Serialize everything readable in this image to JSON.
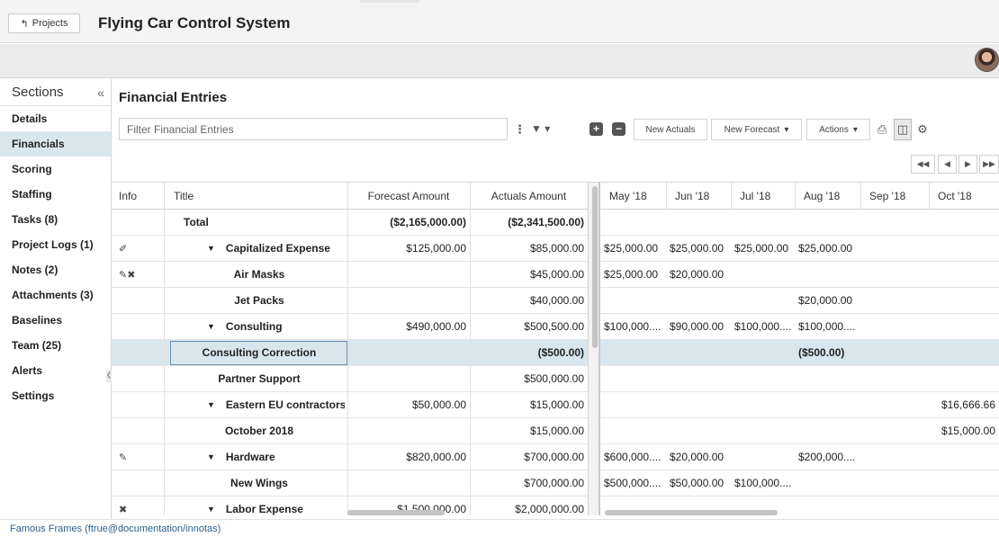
{
  "topbar": {
    "projects_label": "Projects",
    "app_title": "Flying Car Control System"
  },
  "sidebar": {
    "header": "Sections",
    "collapse_glyph": "«",
    "items": [
      {
        "label": "Details"
      },
      {
        "label": "Financials"
      },
      {
        "label": "Scoring"
      },
      {
        "label": "Staffing"
      },
      {
        "label": "Tasks (8)"
      },
      {
        "label": "Project Logs (1)"
      },
      {
        "label": "Notes (2)"
      },
      {
        "label": "Attachments (3)"
      },
      {
        "label": "Baselines"
      },
      {
        "label": "Team (25)"
      },
      {
        "label": "Alerts"
      },
      {
        "label": "Settings"
      }
    ],
    "active_index": 1
  },
  "main": {
    "title": "Financial Entries",
    "filter_placeholder": "Filter Financial Entries",
    "toolbar": {
      "new_actuals": "New Actuals",
      "new_forecast": "New Forecast",
      "actions": "Actions"
    }
  },
  "grid": {
    "headers": {
      "info": "Info",
      "title": "Title",
      "forecast": "Forecast Amount",
      "actuals": "Actuals Amount",
      "months": [
        "May '18",
        "Jun '18",
        "Jul '18",
        "Aug '18",
        "Sep '18",
        "Oct '18"
      ]
    },
    "rows": [
      {
        "title": "Total",
        "forecast": "($2,165,000.00)",
        "actuals": "($2,341,500.00)",
        "months": [
          "",
          "",
          "",
          "",
          "",
          ""
        ],
        "bold_amounts": true
      },
      {
        "info": "paperclip-icon",
        "title": "Capitalized Expense",
        "caret": true,
        "forecast": "$125,000.00",
        "actuals": "$85,000.00",
        "months": [
          "$25,000.00",
          "$25,000.00",
          "$25,000.00",
          "$25,000.00",
          "",
          ""
        ]
      },
      {
        "info": "edit-expand-icons",
        "title": "Air Masks",
        "indent": 2,
        "forecast": "",
        "actuals": "$45,000.00",
        "months": [
          "$25,000.00",
          "$20,000.00",
          "",
          "",
          "",
          ""
        ]
      },
      {
        "title": "Jet Packs",
        "indent": 2,
        "forecast": "",
        "actuals": "$40,000.00",
        "months": [
          "",
          "",
          "",
          "$20,000.00",
          "",
          ""
        ]
      },
      {
        "title": "Consulting",
        "caret": true,
        "forecast": "$490,000.00",
        "actuals": "$500,500.00",
        "months": [
          "$100,000....",
          "$90,000.00",
          "$100,000....",
          "$100,000....",
          "",
          ""
        ]
      },
      {
        "title": "Consulting Correction",
        "indent": 2,
        "forecast": "",
        "actuals": "($500.00)",
        "months": [
          "",
          "",
          "",
          "($500.00)",
          "",
          ""
        ],
        "selected": true
      },
      {
        "title": "Partner Support",
        "indent": 2,
        "forecast": "",
        "actuals": "$500,000.00",
        "months": [
          "",
          "",
          "",
          "",
          "",
          ""
        ]
      },
      {
        "title": "Eastern EU contractors",
        "caret": true,
        "forecast": "$50,000.00",
        "actuals": "$15,000.00",
        "months": [
          "",
          "",
          "",
          "",
          "",
          "$16,666.66"
        ]
      },
      {
        "title": "October 2018",
        "indent": 2,
        "forecast": "",
        "actuals": "$15,000.00",
        "months": [
          "",
          "",
          "",
          "",
          "",
          "$15,000.00"
        ]
      },
      {
        "info": "edit-icon",
        "title": "Hardware",
        "caret": true,
        "forecast": "$820,000.00",
        "actuals": "$700,000.00",
        "months": [
          "$600,000....",
          "$20,000.00",
          "",
          "$200,000....",
          "",
          ""
        ]
      },
      {
        "title": "New Wings",
        "indent": 2,
        "forecast": "",
        "actuals": "$700,000.00",
        "months": [
          "$500,000....",
          "$50,000.00",
          "$100,000....",
          "",
          "",
          ""
        ]
      },
      {
        "info": "expand-icon",
        "title": "Labor Expense",
        "caret": true,
        "forecast": "$1,500,000.00",
        "actuals": "$2,000,000.00",
        "months": [
          "",
          "",
          "",
          "",
          "",
          ""
        ]
      }
    ]
  },
  "footer": {
    "text": "Famous Frames (ftrue@documentation/innotas)"
  },
  "colors": {
    "selected_row": "#dae6ee",
    "active_sidebar": "#d9e6ee",
    "footer_link": "#2b5e8c"
  }
}
